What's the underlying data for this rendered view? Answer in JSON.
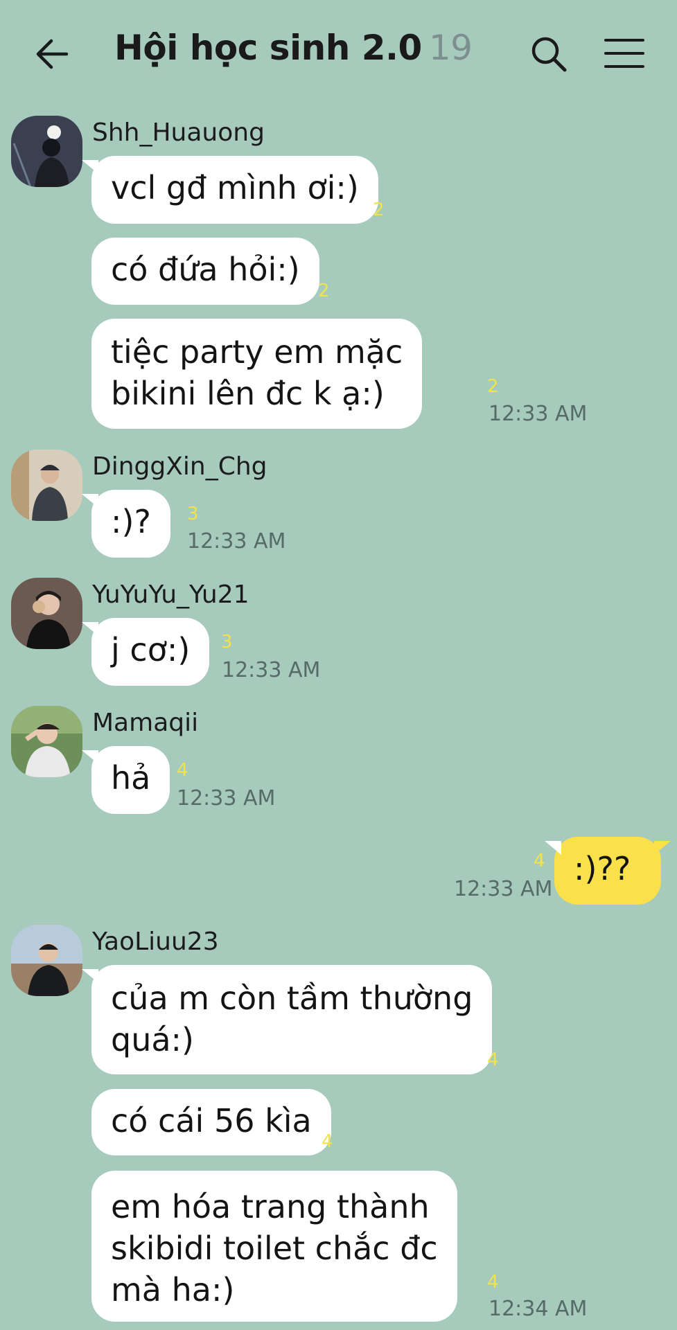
{
  "header": {
    "title": "Hội học sinh 2.0",
    "member_count": "19"
  },
  "messages": [
    {
      "sender": "Shh_Huauong",
      "text": "vcl gđ mình ơi:)",
      "unread": "2",
      "time": ""
    },
    {
      "sender": "",
      "text": "có đứa hỏi:)",
      "unread": "2",
      "time": ""
    },
    {
      "sender": "",
      "text_lines": [
        "tiệc party em mặc",
        "bikini lên đc k ạ:)"
      ],
      "unread": "2",
      "time": "12:33 AM"
    },
    {
      "sender": "DinggXin_Chg",
      "text": ":)?",
      "unread": "3",
      "time": "12:33 AM"
    },
    {
      "sender": "YuYuYu_Yu21",
      "text": "j cơ:)",
      "unread": "3",
      "time": "12:33 AM"
    },
    {
      "sender": "Mamaqii",
      "text": "hả",
      "unread": "4",
      "time": "12:33 AM"
    },
    {
      "sender": "me",
      "text": ":)??",
      "unread": "4",
      "time": "12:33 AM"
    },
    {
      "sender": "YaoLiuu23",
      "text_lines": [
        "của m còn tầm thường",
        "quá:)"
      ],
      "unread": "4",
      "time": ""
    },
    {
      "sender": "",
      "text": "có cái 56 kìa",
      "unread": "4",
      "time": ""
    },
    {
      "sender": "",
      "text_lines": [
        "em hóa trang thành",
        "skibidi toilet chắc đc",
        "mà ha:)"
      ],
      "unread": "4",
      "time": "12:34 AM"
    }
  ],
  "colors": {
    "background": "#a6cbbd",
    "own_bubble": "#fae04a",
    "other_bubble": "#ffffff",
    "unread_count": "#f1e34a"
  },
  "icons": [
    "back-arrow-icon",
    "search-icon",
    "menu-icon"
  ]
}
